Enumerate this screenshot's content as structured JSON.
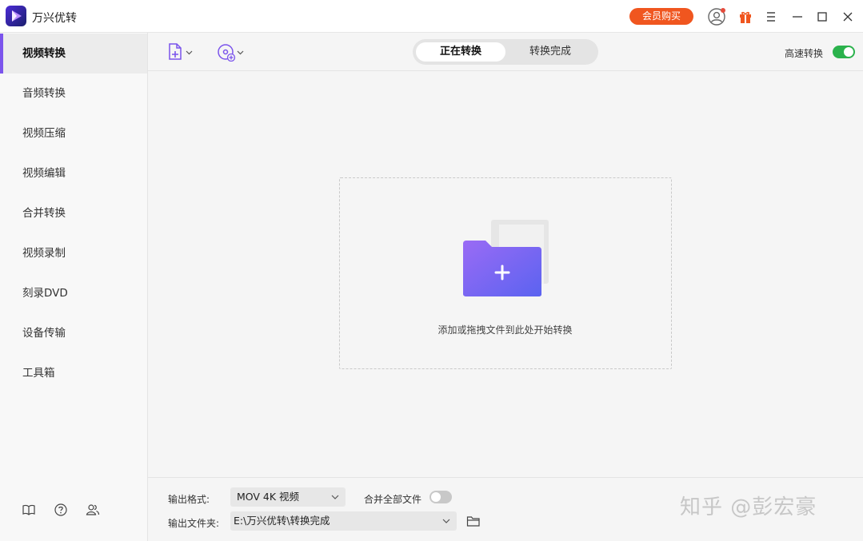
{
  "titlebar": {
    "app_title": "万兴优转",
    "vip_label": "会员购买",
    "icons": [
      "app-logo",
      "avatar-icon",
      "gift-icon",
      "menu-icon",
      "minimize-icon",
      "maximize-icon",
      "close-icon"
    ]
  },
  "colors": {
    "accent": "#7b54ec",
    "vip": "#f0561f",
    "toggle_on": "#2bb24c",
    "folder_front": "#7a5cf3"
  },
  "sidebar": {
    "items": [
      {
        "label": "视频转换",
        "active": true
      },
      {
        "label": "音频转换"
      },
      {
        "label": "视频压缩"
      },
      {
        "label": "视频编辑"
      },
      {
        "label": "合并转换"
      },
      {
        "label": "视频录制"
      },
      {
        "label": "刻录DVD"
      },
      {
        "label": "设备传输"
      },
      {
        "label": "工具箱"
      }
    ],
    "bottom_icons": [
      "book-icon",
      "help-icon",
      "users-icon"
    ]
  },
  "toolbar": {
    "add_file_icon": "add-file-icon",
    "add_disc_icon": "add-disc-icon",
    "tabs": [
      {
        "label": "正在转换",
        "active": true
      },
      {
        "label": "转换完成"
      }
    ],
    "high_speed_label": "高速转换",
    "high_speed_on": true
  },
  "dropzone": {
    "text": "添加或拖拽文件到此处开始转换"
  },
  "bottom": {
    "format_label": "输出格式:",
    "format_value": "MOV 4K 视频",
    "merge_label": "合并全部文件",
    "merge_on": false,
    "folder_label": "输出文件夹:",
    "folder_value": "E:\\万兴优转\\转换完成"
  },
  "watermark": "知乎 @彭宏豪"
}
